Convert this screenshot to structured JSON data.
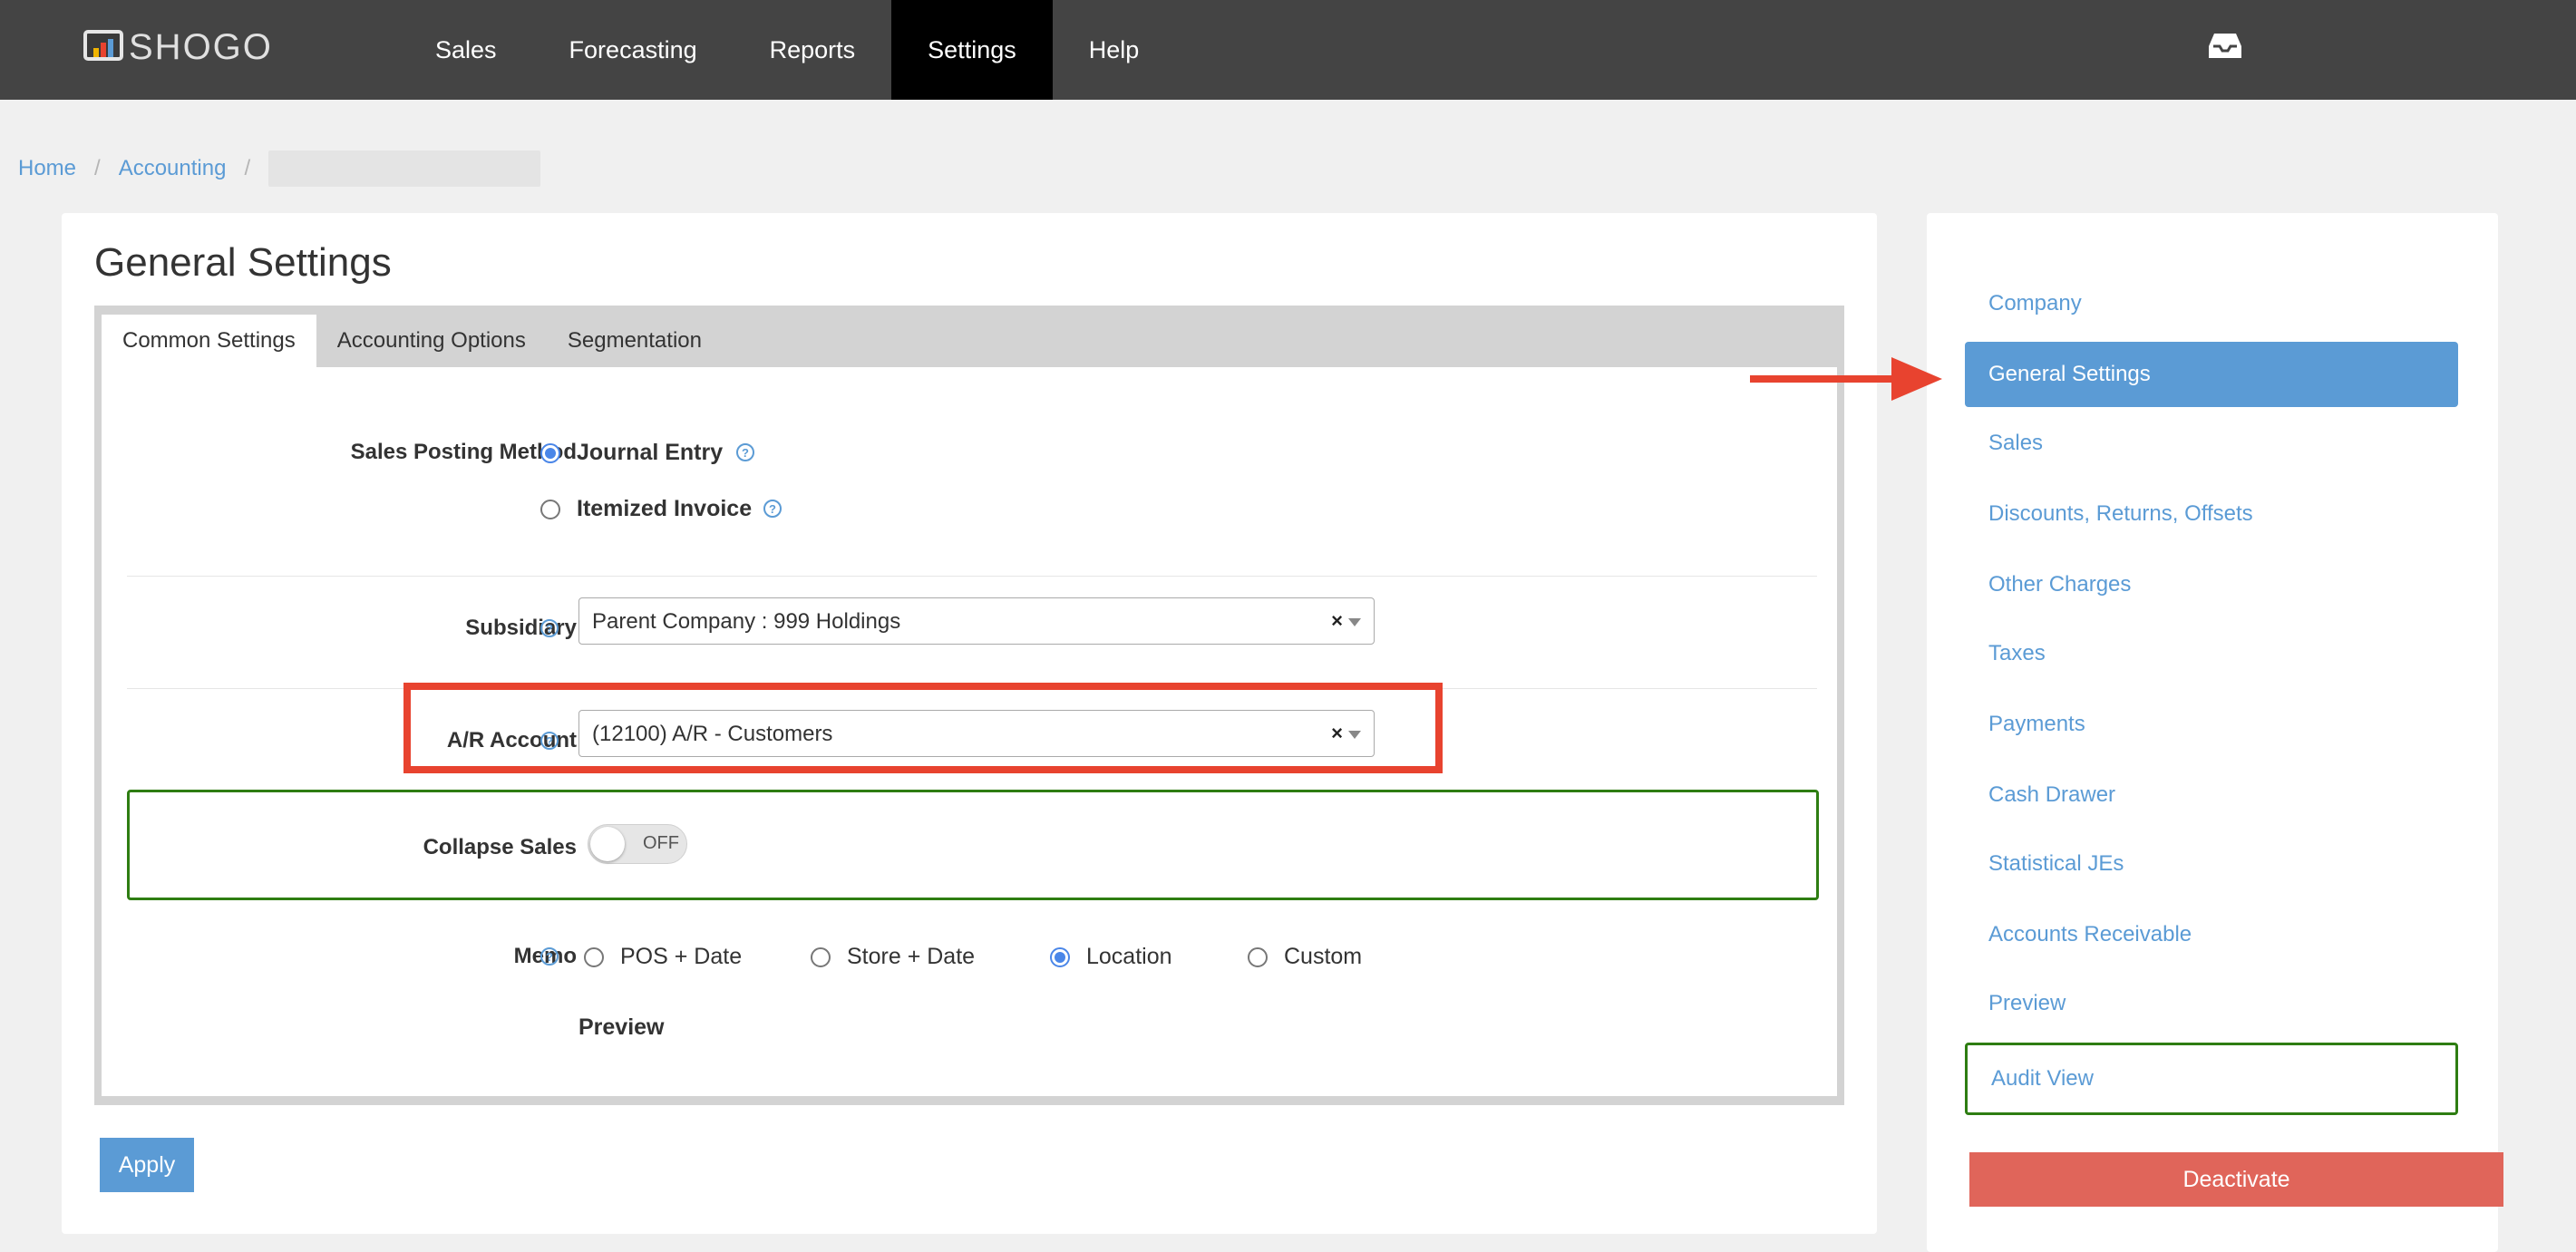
{
  "app": {
    "logo_text": "SHOGO"
  },
  "nav": {
    "items": [
      {
        "label": "Sales"
      },
      {
        "label": "Forecasting"
      },
      {
        "label": "Reports"
      },
      {
        "label": "Settings",
        "active": true
      },
      {
        "label": "Help"
      }
    ]
  },
  "breadcrumb": {
    "home": "Home",
    "accounting": "Accounting",
    "separator": "/"
  },
  "page": {
    "title": "General Settings"
  },
  "tabs": [
    {
      "label": "Common Settings",
      "active": true
    },
    {
      "label": "Accounting Options"
    },
    {
      "label": "Segmentation"
    }
  ],
  "form": {
    "sales_posting": {
      "label": "Sales Posting Method",
      "options": [
        {
          "label": "Journal Entry",
          "selected": true
        },
        {
          "label": "Itemized Invoice",
          "selected": false
        }
      ]
    },
    "subsidiary": {
      "label": "Subsidiary",
      "value": "Parent Company : 999 Holdings",
      "clear": "×"
    },
    "ar_account": {
      "label": "A/R Account",
      "value": "(12100) A/R - Customers",
      "clear": "×"
    },
    "collapse_sales": {
      "label": "Collapse Sales",
      "state": "OFF"
    },
    "memo": {
      "label": "Memo",
      "options": [
        {
          "label": "POS + Date",
          "selected": false
        },
        {
          "label": "Store + Date",
          "selected": false
        },
        {
          "label": "Location",
          "selected": true
        },
        {
          "label": "Custom",
          "selected": false
        }
      ]
    },
    "preview_label": "Preview",
    "apply_label": "Apply"
  },
  "sidebar": {
    "items": [
      {
        "label": "Company"
      },
      {
        "label": "General Settings",
        "active": true
      },
      {
        "label": "Sales"
      },
      {
        "label": "Discounts, Returns, Offsets"
      },
      {
        "label": "Other Charges"
      },
      {
        "label": "Taxes"
      },
      {
        "label": "Payments"
      },
      {
        "label": "Cash Drawer"
      },
      {
        "label": "Statistical JEs"
      },
      {
        "label": "Accounts Receivable"
      },
      {
        "label": "Preview"
      },
      {
        "label": "Audit View"
      }
    ],
    "deactivate_label": "Deactivate"
  },
  "colors": {
    "nav_bg": "#444444",
    "accent": "#5b9bd5",
    "annotation_red": "#e8432f",
    "annotation_green": "#2e7d12",
    "danger": "#e0655a"
  }
}
